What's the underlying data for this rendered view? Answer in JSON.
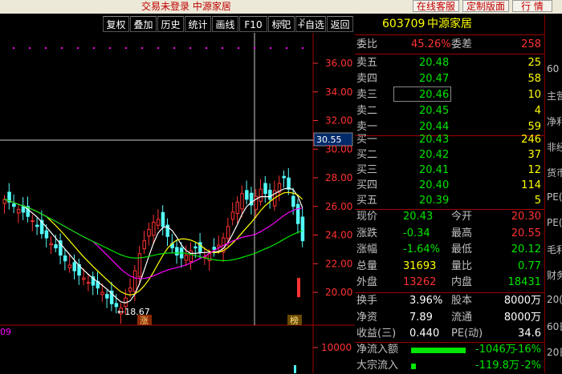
{
  "title": "交易未登录  中源家居",
  "top_buttons": {
    "online_service": "在线客服",
    "custom_layout": "定制版面",
    "quotes": "行 情"
  },
  "toolbar": [
    "复权",
    "叠加",
    "历史",
    "统计",
    "画线",
    "F10",
    "标记",
    "+自选",
    "返回"
  ],
  "chart": {
    "price_ticks": [
      "36.00",
      "34.00",
      "32.00",
      "30.00",
      "28.00",
      "26.00",
      "24.00",
      "22.00",
      "20.00"
    ],
    "crosshair_label": "30.55",
    "low_label": "18.67",
    "volume_tick": "10000",
    "left_label": "09",
    "badge_zhang": "涨",
    "badge_bang": "榜"
  },
  "colors": {
    "up": "#ff3232",
    "down": "#54fcfc",
    "ma5": "#ffffff",
    "ma10": "#ffff00",
    "ma20": "#ff00ff",
    "ma60": "#00e600"
  },
  "panel": {
    "code": "603709",
    "name": "中源家居",
    "weibi_label": "委比",
    "weibi_value": "45.26%",
    "weicha_label": "委差",
    "weicha_value": "258",
    "asks": [
      {
        "label": "卖五",
        "price": "20.48",
        "vol": "25"
      },
      {
        "label": "卖四",
        "price": "20.47",
        "vol": "58"
      },
      {
        "label": "卖三",
        "price": "20.46",
        "vol": "10"
      },
      {
        "label": "卖二",
        "price": "20.45",
        "vol": "4"
      },
      {
        "label": "卖一",
        "price": "20.44",
        "vol": "59"
      }
    ],
    "bids": [
      {
        "label": "买一",
        "price": "20.43",
        "vol": "246"
      },
      {
        "label": "买二",
        "price": "20.42",
        "vol": "37"
      },
      {
        "label": "买三",
        "price": "20.41",
        "vol": "12"
      },
      {
        "label": "买四",
        "price": "20.40",
        "vol": "114"
      },
      {
        "label": "买五",
        "price": "20.39",
        "vol": "5"
      }
    ],
    "stats": [
      {
        "l1": "现价",
        "v1": "20.43",
        "l2": "今开",
        "v2": "20.30"
      },
      {
        "l1": "涨跌",
        "v1": "-0.34",
        "l2": "最高",
        "v2": "20.55"
      },
      {
        "l1": "涨幅",
        "v1": "-1.64%",
        "l2": "最低",
        "v2": "20.12"
      },
      {
        "l1": "总量",
        "v1": "31693",
        "l2": "量比",
        "v2": "0.77"
      },
      {
        "l1": "外盘",
        "v1": "13262",
        "l2": "内盘",
        "v2": "18431"
      }
    ],
    "stats2": [
      {
        "l1": "换手",
        "v1": "3.96%",
        "l2": "股本",
        "v2": "8000万"
      },
      {
        "l1": "净资",
        "v1": "7.89",
        "l2": "流通",
        "v2": "8000万"
      },
      {
        "l1": "收益(三)",
        "v1": "0.440",
        "l2": "PE(动)",
        "v2": "34.6"
      }
    ],
    "netflow_label": "净流入额",
    "netflow_value": "-1046万",
    "netflow_pct": "-16%",
    "block_label": "大宗流入",
    "block_value": "-119.8万",
    "block_pct": "-2%"
  },
  "far_right": [
    "60",
    "主营",
    "净利",
    "非经",
    "货币",
    "PE(",
    "PE(",
    "毛利",
    "财务",
    "20(",
    "60日",
    "20日"
  ]
}
